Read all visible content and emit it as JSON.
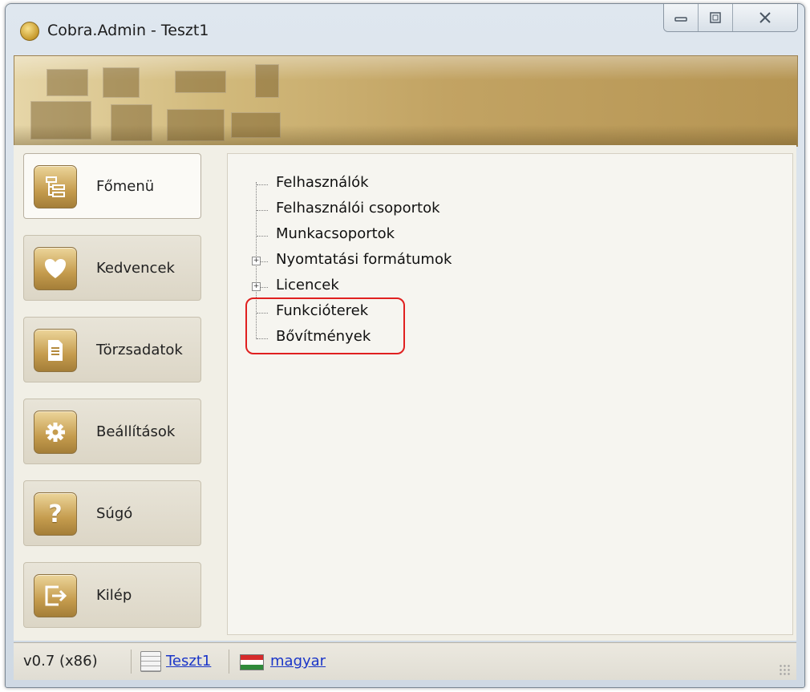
{
  "window": {
    "title": "Cobra.Admin - Teszt1"
  },
  "caption_buttons": {
    "minimize_icon": "minimize-icon",
    "maximize_icon": "maximize-icon",
    "close_icon": "close-icon"
  },
  "sidebar": {
    "items": [
      {
        "label": "Főmenü",
        "icon": "tree-menu-icon",
        "glyph": "☰"
      },
      {
        "label": "Kedvencek",
        "icon": "heart-icon",
        "glyph": "❤"
      },
      {
        "label": "Törzsadatok",
        "icon": "document-icon",
        "glyph": "▤"
      },
      {
        "label": "Beállítások",
        "icon": "gear-icon",
        "glyph": "✹"
      },
      {
        "label": "Súgó",
        "icon": "help-icon",
        "glyph": "?"
      },
      {
        "label": "Kilép",
        "icon": "exit-icon",
        "glyph": "⇥"
      }
    ]
  },
  "tree": {
    "items": [
      {
        "label": "Felhasználók",
        "expandable": false
      },
      {
        "label": "Felhasználói csoportok",
        "expandable": false
      },
      {
        "label": "Munkacsoportok",
        "expandable": false
      },
      {
        "label": "Nyomtatási formátumok",
        "expandable": true
      },
      {
        "label": "Licencek",
        "expandable": true
      },
      {
        "label": "Funkcióterek",
        "expandable": false
      },
      {
        "label": "Bővítmények",
        "expandable": false
      }
    ]
  },
  "statusbar": {
    "version": "v0.7 (x86)",
    "database_link": "Teszt1",
    "language_link": "magyar"
  },
  "colors": {
    "accent_gold": "#c59c4e",
    "highlight_red": "#e02020",
    "link_blue": "#1a35c8"
  }
}
